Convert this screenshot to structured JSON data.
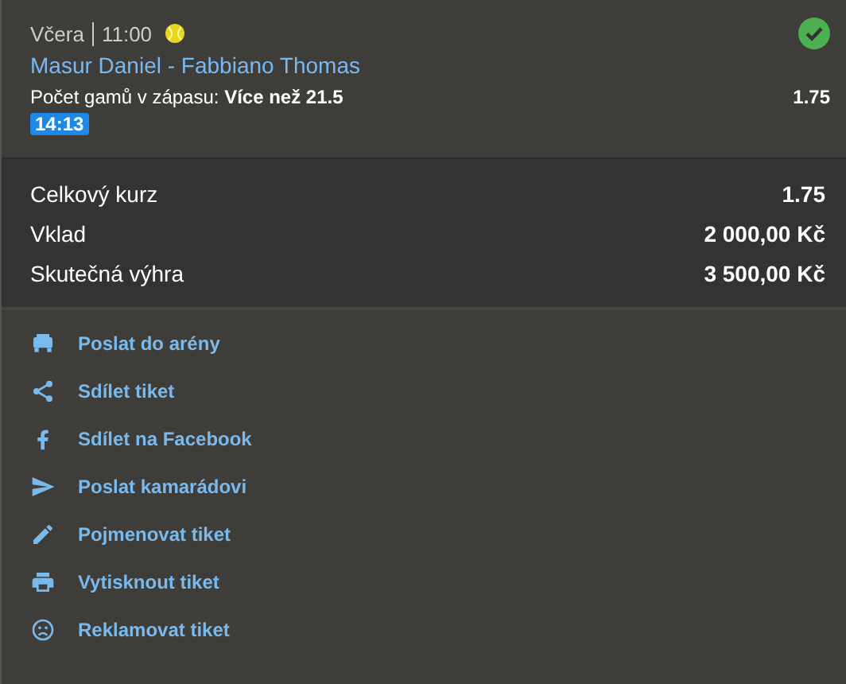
{
  "bet": {
    "day": "Včera",
    "time": "11:00",
    "won": true,
    "match": "Masur Daniel - Fabbiano Thomas",
    "market": "Počet gamů v zápasu: ",
    "selection": "Více než 21.5",
    "odds": "1.75",
    "score_time": "14:13"
  },
  "summary": [
    {
      "label": "Celkový kurz",
      "value": "1.75"
    },
    {
      "label": "Vklad",
      "value": "2 000,00 Kč"
    },
    {
      "label": "Skutečná výhra",
      "value": "3 500,00 Kč"
    }
  ],
  "actions": [
    {
      "kind": "arena",
      "label": "Poslat do arény"
    },
    {
      "kind": "share",
      "label": "Sdílet tiket"
    },
    {
      "kind": "facebook",
      "label": "Sdílet na Facebook"
    },
    {
      "kind": "send",
      "label": "Poslat kamarádovi"
    },
    {
      "kind": "edit",
      "label": "Pojmenovat tiket"
    },
    {
      "kind": "print",
      "label": "Vytisknout tiket"
    },
    {
      "kind": "complain",
      "label": "Reklamovat tiket"
    }
  ]
}
